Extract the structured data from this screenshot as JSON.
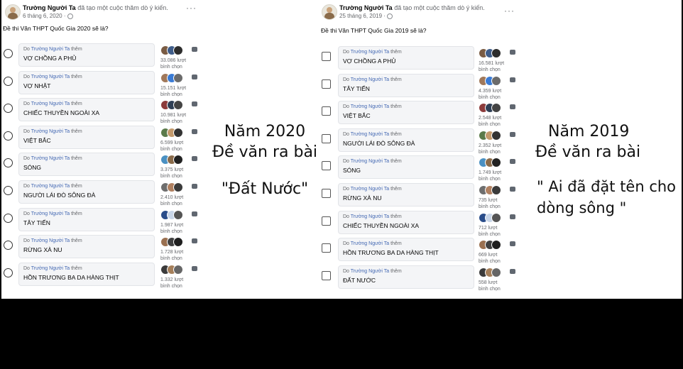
{
  "left_post": {
    "author": "Trường Người Ta",
    "action": "đã tạo một cuộc thăm dò ý kiến.",
    "date": "6 tháng 6, 2020 ·",
    "more": "···",
    "question": "Đề thi Văn THPT Quốc Gia 2020 sẽ là?",
    "options": [
      {
        "adder_prefix": "Do",
        "adder": "Trường Người Ta",
        "adder_suffix": "thêm",
        "label": "VỢ CHỒNG A PHỦ",
        "votes": "33.086 lượt",
        "votes_unit": "bình chọn"
      },
      {
        "adder_prefix": "Do",
        "adder": "Trường Người Ta",
        "adder_suffix": "thêm",
        "label": "VỢ NHẶT",
        "votes": "15.151 lượt",
        "votes_unit": "bình chọn"
      },
      {
        "adder_prefix": "Do",
        "adder": "Trường Người Ta",
        "adder_suffix": "thêm",
        "label": "CHIẾC THUYỀN NGOÀI XA",
        "votes": "10.981 lượt",
        "votes_unit": "bình chọn"
      },
      {
        "adder_prefix": "Do",
        "adder": "Trường Người Ta",
        "adder_suffix": "thêm",
        "label": "VIỆT BẮC",
        "votes": "6.599 lượt",
        "votes_unit": "bình chọn"
      },
      {
        "adder_prefix": "Do",
        "adder": "Trường Người Ta",
        "adder_suffix": "thêm",
        "label": "SÓNG",
        "votes": "3.375 lượt",
        "votes_unit": "bình chọn"
      },
      {
        "adder_prefix": "Do",
        "adder": "Trường Người Ta",
        "adder_suffix": "thêm",
        "label": "NGƯỜI LÁI ĐÒ SÔNG ĐÀ",
        "votes": "2.410 lượt",
        "votes_unit": "bình chọn"
      },
      {
        "adder_prefix": "Do",
        "adder": "Trường Người Ta",
        "adder_suffix": "thêm",
        "label": "TÂY TIẾN",
        "votes": "1.987 lượt",
        "votes_unit": "bình chọn"
      },
      {
        "adder_prefix": "Do",
        "adder": "Trường Người Ta",
        "adder_suffix": "thêm",
        "label": "RỪNG XÀ NU",
        "votes": "1.728 lượt",
        "votes_unit": "bình chọn"
      },
      {
        "adder_prefix": "Do",
        "adder": "Trường Người Ta",
        "adder_suffix": "thêm",
        "label": "HỒN TRƯƠNG BA DA HÀNG THỊT",
        "votes": "1.332 lượt",
        "votes_unit": "bình chọn"
      }
    ]
  },
  "right_post": {
    "author": "Trường Người Ta",
    "action": "đã tạo một cuộc thăm dò ý kiến.",
    "date": "25 tháng 6, 2019 ·",
    "more": "···",
    "question": "Đề thi Văn THPT Quốc Gia 2019 sẽ là?",
    "options": [
      {
        "adder_prefix": "Do",
        "adder": "Trường Người Ta",
        "adder_suffix": "thêm",
        "label": "VỢ CHỒNG A PHỦ",
        "votes": "16.581 lượt",
        "votes_unit": "bình chọn"
      },
      {
        "adder_prefix": "Do",
        "adder": "Trường Người Ta",
        "adder_suffix": "thêm",
        "label": "TÂY TIẾN",
        "votes": "4.359 lượt",
        "votes_unit": "bình chọn"
      },
      {
        "adder_prefix": "Do",
        "adder": "Trường Người Ta",
        "adder_suffix": "thêm",
        "label": "VIỆT BẮC",
        "votes": "2.548 lượt",
        "votes_unit": "bình chọn"
      },
      {
        "adder_prefix": "Do",
        "adder": "Trường Người Ta",
        "adder_suffix": "thêm",
        "label": "NGƯỜI LÁI ĐÒ SÔNG ĐÀ",
        "votes": "2.352 lượt",
        "votes_unit": "bình chọn"
      },
      {
        "adder_prefix": "Do",
        "adder": "Trường Người Ta",
        "adder_suffix": "thêm",
        "label": "SÓNG",
        "votes": "1.749 lượt",
        "votes_unit": "bình chọn"
      },
      {
        "adder_prefix": "Do",
        "adder": "Trường Người Ta",
        "adder_suffix": "thêm",
        "label": "RỪNG XÀ NU",
        "votes": "735 lượt",
        "votes_unit": "bình chọn"
      },
      {
        "adder_prefix": "Do",
        "adder": "Trường Người Ta",
        "adder_suffix": "thêm",
        "label": "CHIẾC THUYỀN NGOÀI XA",
        "votes": "712 lượt",
        "votes_unit": "bình chọn"
      },
      {
        "adder_prefix": "Do",
        "adder": "Trường Người Ta",
        "adder_suffix": "thêm",
        "label": "HỒN TRƯƠNG BA DA HÀNG THỊT",
        "votes": "669 lượt",
        "votes_unit": "bình chọn"
      },
      {
        "adder_prefix": "Do",
        "adder": "Trường Người Ta",
        "adder_suffix": "thêm",
        "label": "ĐẤT NƯỚC",
        "votes": "558 lượt",
        "votes_unit": "bình chọn"
      }
    ]
  },
  "caption_2020": {
    "line1": "Năm 2020",
    "line2": "Đề văn ra bài",
    "line3": "\"Đất Nước\""
  },
  "caption_2019": {
    "line1": "Năm 2019",
    "line2": "Đề văn ra bài",
    "line3": "\" Ai đã đặt tên cho",
    "line4": "dòng sông \""
  },
  "colors": {
    "link": "#4267b2",
    "muted": "#65676b",
    "option_bg": "#f4f5f7"
  },
  "icons": {
    "avatar": "profile-picture",
    "privacy": "globe-icon",
    "more": "more-options-icon"
  }
}
